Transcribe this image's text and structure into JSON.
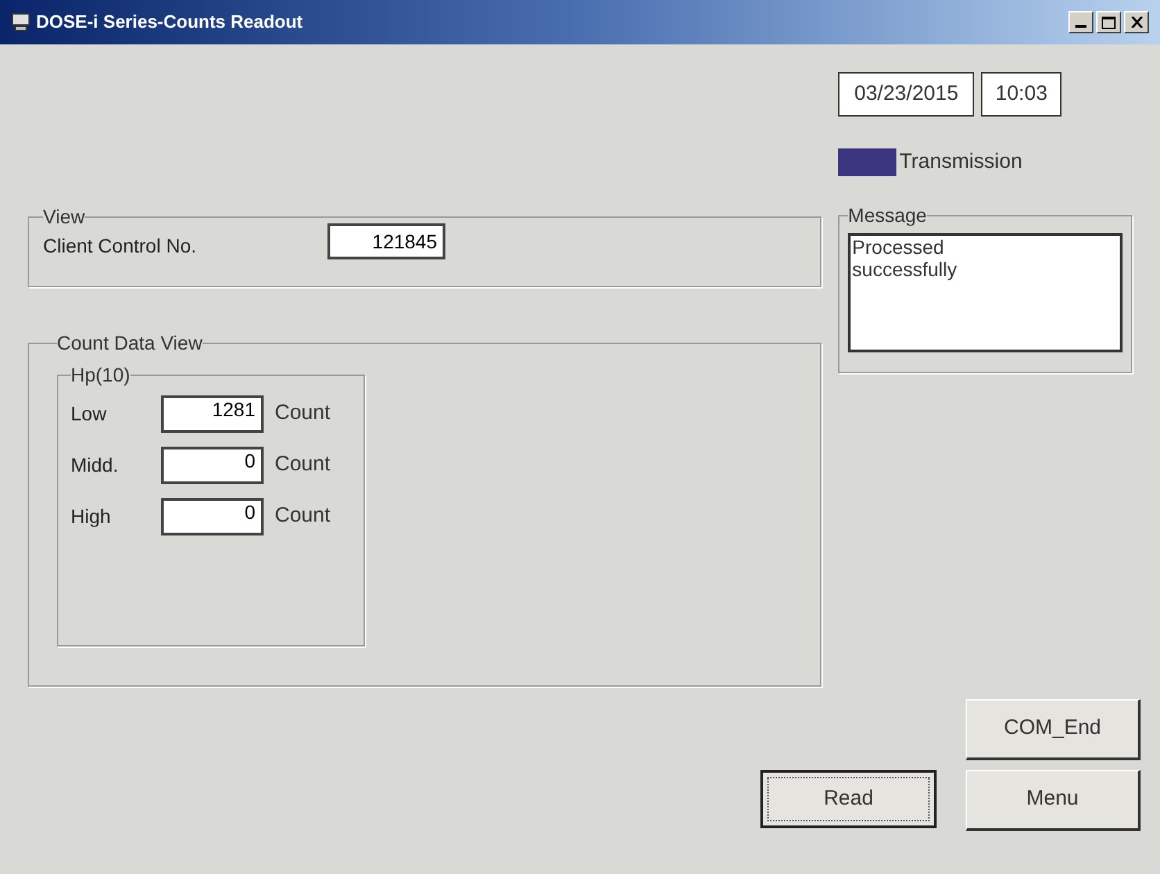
{
  "window": {
    "title": "DOSE-i Series-Counts Readout"
  },
  "date": "03/23/2015",
  "time": "10:03",
  "transmission": {
    "label": "Transmission",
    "color": "#3b3580"
  },
  "view": {
    "title": "View",
    "label": "Client Control No.",
    "value": "121845"
  },
  "message": {
    "title": "Message",
    "text": "Processed\nsuccessfully"
  },
  "count_data": {
    "title": "Count Data View",
    "group": "Hp(10)",
    "rows": [
      {
        "label": "Low",
        "value": "1281",
        "unit": "Count"
      },
      {
        "label": "Midd.",
        "value": "0",
        "unit": "Count"
      },
      {
        "label": "High",
        "value": "0",
        "unit": "Count"
      }
    ]
  },
  "buttons": [
    {
      "label": "COM_End",
      "focused": false
    },
    {
      "label": "Read",
      "focused": true
    },
    {
      "label": "Menu",
      "focused": false
    }
  ]
}
